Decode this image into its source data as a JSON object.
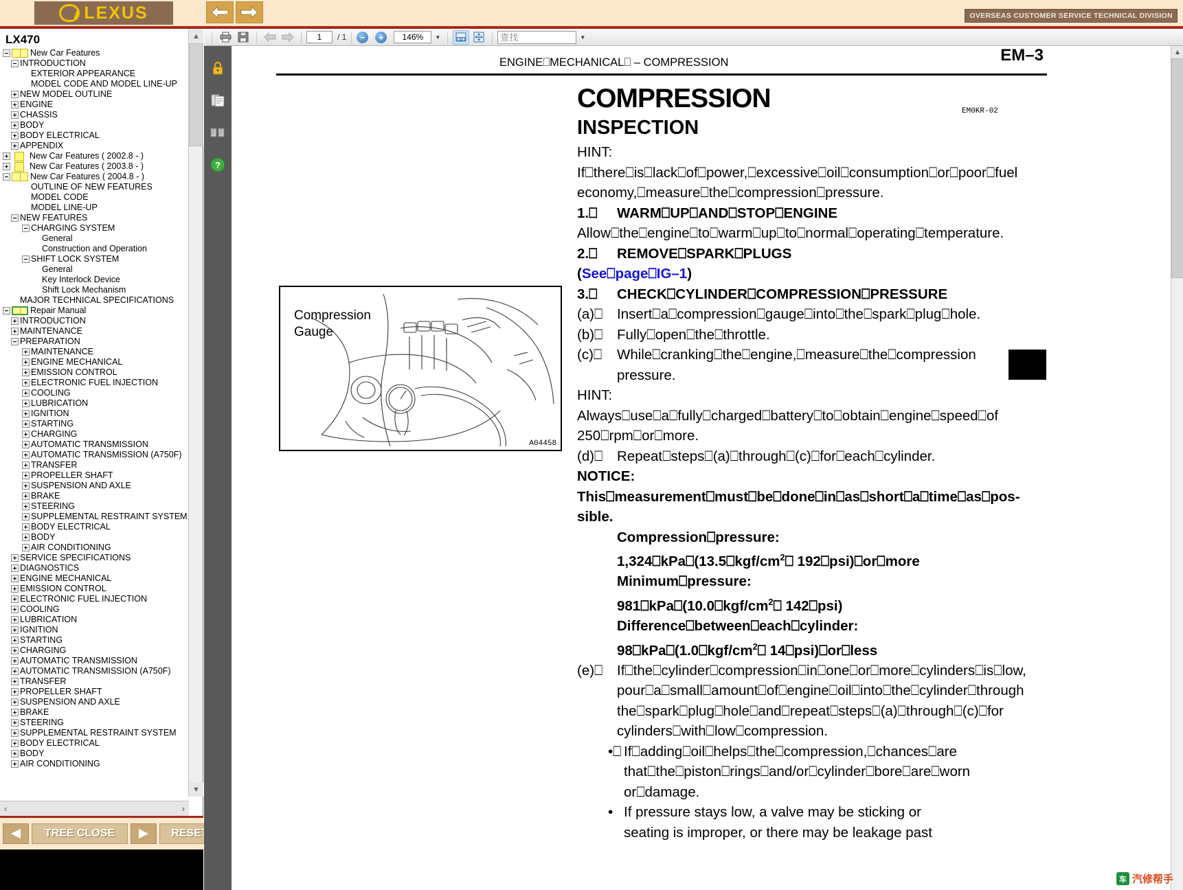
{
  "banner": {
    "logo_text": "LEXUS",
    "back_arrow": "back-arrow",
    "forward_arrow": "forward-arrow",
    "division_tag": "OVERSEAS CUSTOMER SERVICE TECHNICAL DIVISION"
  },
  "tree": {
    "title": "LX470",
    "items": [
      {
        "depth": 0,
        "toggle": "minus",
        "icon": "book",
        "label": "New Car Features"
      },
      {
        "depth": 1,
        "toggle": "minus",
        "icon": "none",
        "label": "INTRODUCTION"
      },
      {
        "depth": 2,
        "toggle": "none",
        "icon": "none",
        "label": "EXTERIOR APPEARANCE"
      },
      {
        "depth": 2,
        "toggle": "none",
        "icon": "none",
        "label": "MODEL CODE AND MODEL LINE-UP"
      },
      {
        "depth": 1,
        "toggle": "plus",
        "icon": "none",
        "label": "NEW MODEL OUTLINE"
      },
      {
        "depth": 1,
        "toggle": "plus",
        "icon": "none",
        "label": "ENGINE"
      },
      {
        "depth": 1,
        "toggle": "plus",
        "icon": "none",
        "label": "CHASSIS"
      },
      {
        "depth": 1,
        "toggle": "plus",
        "icon": "none",
        "label": "BODY"
      },
      {
        "depth": 1,
        "toggle": "plus",
        "icon": "none",
        "label": "BODY ELECTRICAL"
      },
      {
        "depth": 1,
        "toggle": "plus",
        "icon": "none",
        "label": "APPENDIX"
      },
      {
        "depth": 0,
        "toggle": "plus",
        "icon": "note",
        "label": "New Car Features ( 2002.8 - )"
      },
      {
        "depth": 0,
        "toggle": "plus",
        "icon": "note",
        "label": "New Car Features ( 2003.8 - )"
      },
      {
        "depth": 0,
        "toggle": "minus",
        "icon": "book",
        "label": "New Car Features ( 2004.8 - )"
      },
      {
        "depth": 2,
        "toggle": "none",
        "icon": "none",
        "label": "OUTLINE OF NEW FEATURES"
      },
      {
        "depth": 2,
        "toggle": "none",
        "icon": "none",
        "label": "MODEL CODE"
      },
      {
        "depth": 2,
        "toggle": "none",
        "icon": "none",
        "label": "MODEL LINE-UP"
      },
      {
        "depth": 1,
        "toggle": "minus",
        "icon": "none",
        "label": "NEW FEATURES"
      },
      {
        "depth": 2,
        "toggle": "minus",
        "icon": "none",
        "label": "CHARGING SYSTEM"
      },
      {
        "depth": 3,
        "toggle": "none",
        "icon": "none",
        "label": "General"
      },
      {
        "depth": 3,
        "toggle": "none",
        "icon": "none",
        "label": "Construction and Operation"
      },
      {
        "depth": 2,
        "toggle": "minus",
        "icon": "none",
        "label": "SHIFT LOCK SYSTEM"
      },
      {
        "depth": 3,
        "toggle": "none",
        "icon": "none",
        "label": "General"
      },
      {
        "depth": 3,
        "toggle": "none",
        "icon": "none",
        "label": "Key Interlock Device"
      },
      {
        "depth": 3,
        "toggle": "none",
        "icon": "none",
        "label": "Shift Lock Mechanism"
      },
      {
        "depth": 1,
        "toggle": "none",
        "icon": "none",
        "label": "MAJOR TECHNICAL SPECIFICATIONS"
      },
      {
        "depth": 0,
        "toggle": "minus",
        "icon": "book-green",
        "label": "Repair Manual"
      },
      {
        "depth": 1,
        "toggle": "plus",
        "icon": "none",
        "label": "INTRODUCTION"
      },
      {
        "depth": 1,
        "toggle": "plus",
        "icon": "none",
        "label": "MAINTENANCE"
      },
      {
        "depth": 1,
        "toggle": "minus",
        "icon": "none",
        "label": "PREPARATION"
      },
      {
        "depth": 2,
        "toggle": "plus",
        "icon": "none",
        "label": "MAINTENANCE"
      },
      {
        "depth": 2,
        "toggle": "plus",
        "icon": "none",
        "label": "ENGINE MECHANICAL"
      },
      {
        "depth": 2,
        "toggle": "plus",
        "icon": "none",
        "label": "EMISSION CONTROL"
      },
      {
        "depth": 2,
        "toggle": "plus",
        "icon": "none",
        "label": "ELECTRONIC FUEL INJECTION"
      },
      {
        "depth": 2,
        "toggle": "plus",
        "icon": "none",
        "label": "COOLING"
      },
      {
        "depth": 2,
        "toggle": "plus",
        "icon": "none",
        "label": "LUBRICATION"
      },
      {
        "depth": 2,
        "toggle": "plus",
        "icon": "none",
        "label": "IGNITION"
      },
      {
        "depth": 2,
        "toggle": "plus",
        "icon": "none",
        "label": "STARTING"
      },
      {
        "depth": 2,
        "toggle": "plus",
        "icon": "none",
        "label": "CHARGING"
      },
      {
        "depth": 2,
        "toggle": "plus",
        "icon": "none",
        "label": "AUTOMATIC TRANSMISSION"
      },
      {
        "depth": 2,
        "toggle": "plus",
        "icon": "none",
        "label": "AUTOMATIC TRANSMISSION (A750F)"
      },
      {
        "depth": 2,
        "toggle": "plus",
        "icon": "none",
        "label": "TRANSFER"
      },
      {
        "depth": 2,
        "toggle": "plus",
        "icon": "none",
        "label": "PROPELLER SHAFT"
      },
      {
        "depth": 2,
        "toggle": "plus",
        "icon": "none",
        "label": "SUSPENSION AND AXLE"
      },
      {
        "depth": 2,
        "toggle": "plus",
        "icon": "none",
        "label": "BRAKE"
      },
      {
        "depth": 2,
        "toggle": "plus",
        "icon": "none",
        "label": "STEERING"
      },
      {
        "depth": 2,
        "toggle": "plus",
        "icon": "none",
        "label": "SUPPLEMENTAL RESTRAINT SYSTEM"
      },
      {
        "depth": 2,
        "toggle": "plus",
        "icon": "none",
        "label": "BODY ELECTRICAL"
      },
      {
        "depth": 2,
        "toggle": "plus",
        "icon": "none",
        "label": "BODY"
      },
      {
        "depth": 2,
        "toggle": "plus",
        "icon": "none",
        "label": "AIR CONDITIONING"
      },
      {
        "depth": 1,
        "toggle": "plus",
        "icon": "none",
        "label": "SERVICE SPECIFICATIONS"
      },
      {
        "depth": 1,
        "toggle": "plus",
        "icon": "none",
        "label": "DIAGNOSTICS"
      },
      {
        "depth": 1,
        "toggle": "plus",
        "icon": "none",
        "label": "ENGINE MECHANICAL"
      },
      {
        "depth": 1,
        "toggle": "plus",
        "icon": "none",
        "label": "EMISSION CONTROL"
      },
      {
        "depth": 1,
        "toggle": "plus",
        "icon": "none",
        "label": "ELECTRONIC FUEL INJECTION"
      },
      {
        "depth": 1,
        "toggle": "plus",
        "icon": "none",
        "label": "COOLING"
      },
      {
        "depth": 1,
        "toggle": "plus",
        "icon": "none",
        "label": "LUBRICATION"
      },
      {
        "depth": 1,
        "toggle": "plus",
        "icon": "none",
        "label": "IGNITION"
      },
      {
        "depth": 1,
        "toggle": "plus",
        "icon": "none",
        "label": "STARTING"
      },
      {
        "depth": 1,
        "toggle": "plus",
        "icon": "none",
        "label": "CHARGING"
      },
      {
        "depth": 1,
        "toggle": "plus",
        "icon": "none",
        "label": "AUTOMATIC TRANSMISSION"
      },
      {
        "depth": 1,
        "toggle": "plus",
        "icon": "none",
        "label": "AUTOMATIC TRANSMISSION (A750F)"
      },
      {
        "depth": 1,
        "toggle": "plus",
        "icon": "none",
        "label": "TRANSFER"
      },
      {
        "depth": 1,
        "toggle": "plus",
        "icon": "none",
        "label": "PROPELLER SHAFT"
      },
      {
        "depth": 1,
        "toggle": "plus",
        "icon": "none",
        "label": "SUSPENSION AND AXLE"
      },
      {
        "depth": 1,
        "toggle": "plus",
        "icon": "none",
        "label": "BRAKE"
      },
      {
        "depth": 1,
        "toggle": "plus",
        "icon": "none",
        "label": "STEERING"
      },
      {
        "depth": 1,
        "toggle": "plus",
        "icon": "none",
        "label": "SUPPLEMENTAL RESTRAINT SYSTEM"
      },
      {
        "depth": 1,
        "toggle": "plus",
        "icon": "none",
        "label": "BODY ELECTRICAL"
      },
      {
        "depth": 1,
        "toggle": "plus",
        "icon": "none",
        "label": "BODY"
      },
      {
        "depth": 1,
        "toggle": "plus",
        "icon": "none",
        "label": "AIR CONDITIONING"
      }
    ],
    "hscroll_left": "‹",
    "hscroll_right": "›"
  },
  "bottom_bar": {
    "prev_label": "prev-arrow",
    "tree_close_label": "TREE CLOSE",
    "next_label": "next-arrow",
    "reset_label": "RESET"
  },
  "toolbar": {
    "page_current": "1",
    "page_total": "/ 1",
    "zoom_value": "146%",
    "zoom_out": "−",
    "zoom_in": "+",
    "search_placeholder": "查找",
    "caret": "▼"
  },
  "rail": {
    "icons": [
      "lock-icon",
      "pages-icon",
      "signature-icon",
      "help-icon"
    ]
  },
  "document": {
    "header": "ENGINE⎕MECHANICAL⎕ –    COMPRESSION",
    "page_label": "EM–3",
    "doc_code": "EM0KR-02",
    "title": "COMPRESSION",
    "subtitle": "INSPECTION",
    "figure": {
      "label_line1": "Compression",
      "label_line2": "Gauge",
      "code": "A04458"
    },
    "lines": {
      "hint1": "HINT:",
      "p1a": "If⎕there⎕is⎕lack⎕of⎕power,⎕excessive⎕oil⎕consumption⎕or⎕poor⎕fuel",
      "p1b": "economy,⎕measure⎕the⎕compression⎕pressure.",
      "step1_num": "1.⎕",
      "step1_txt": "WARM⎕UP⎕AND⎕STOP⎕ENGINE",
      "step1_body": "Allow⎕the⎕engine⎕to⎕warm⎕up⎕to⎕normal⎕operating⎕temperature.",
      "step2_num": "2.⎕",
      "step2_txt": "REMOVE⎕SPARK⎕PLUGS",
      "step2_ref_open": "(",
      "step2_ref_link": "See⎕page⎕IG–1",
      "step2_ref_close": ")",
      "step3_num": "3.⎕",
      "step3_txt": "CHECK⎕CYLINDER⎕COMPRESSION⎕PRESSURE",
      "a_lab": "(a)⎕",
      "a_txt": "Insert⎕a⎕compression⎕gauge⎕into⎕the⎕spark⎕plug⎕hole.",
      "b_lab": "(b)⎕",
      "b_txt": "Fully⎕open⎕the⎕throttle.",
      "c_lab": "(c)⎕",
      "c_txt": "While⎕cranking⎕the⎕engine,⎕measure⎕the⎕compression",
      "c_txt2": "pressure.",
      "hint2": "HINT:",
      "p2a": "Always⎕use⎕a⎕fully⎕charged⎕battery⎕to⎕obtain⎕engine⎕speed⎕of",
      "p2b": "250⎕rpm⎕or⎕more.",
      "d_lab": "(d)⎕",
      "d_txt": "Repeat⎕steps⎕(a)⎕through⎕(c)⎕for⎕each⎕cylinder.",
      "notice": "NOTICE:",
      "notice_a": "This⎕measurement⎕must⎕be⎕done⎕in⎕as⎕short⎕a⎕time⎕as⎕pos-",
      "notice_b": "sible.",
      "spec1_title": "Compression⎕pressure:",
      "spec1_val_pre": "1,324⎕kPa⎕(13.5⎕kgf/cm",
      "spec1_val_sup": "2",
      "spec1_val_post": "⎕ 192⎕psi)⎕or⎕more",
      "spec2_title": "Minimum⎕pressure:",
      "spec2_val_pre": "981⎕kPa⎕(10.0⎕kgf/cm",
      "spec2_val_sup": "2",
      "spec2_val_post": "⎕ 142⎕psi)",
      "spec3_title": "Difference⎕between⎕each⎕cylinder:",
      "spec3_val_pre": "98⎕kPa⎕(1.0⎕kgf/cm",
      "spec3_val_sup": "2",
      "spec3_val_post": "⎕ 14⎕psi)⎕or⎕less",
      "e_lab": "(e)⎕",
      "e_txt1": "If⎕the⎕cylinder⎕compression⎕in⎕one⎕or⎕more⎕cylinders⎕is⎕low,",
      "e_txt2": "pour⎕a⎕small⎕amount⎕of⎕engine⎕oil⎕into⎕the⎕cylinder⎕through",
      "e_txt3": "the⎕spark⎕plug⎕hole⎕and⎕repeat⎕steps⎕(a)⎕through⎕(c)⎕for",
      "e_txt4": "cylinders⎕with⎕low⎕compression.",
      "bullet1_mark": "•⎕",
      "bullet1_a": "If⎕adding⎕oil⎕helps⎕the⎕compression,⎕chances⎕are",
      "bullet1_b": "that⎕the⎕piston⎕rings⎕and/or⎕cylinder⎕bore⎕are⎕worn",
      "bullet1_c": "or⎕damage.",
      "bullet2_mark": "•",
      "bullet2_a": "If  pressure  stays  low,  a  valve  may  be  sticking  or",
      "bullet2_b": "seating  is  improper,  or  there  may  be  leakage  past"
    }
  },
  "watermark": {
    "text": "汽修帮手",
    "badge": "车"
  }
}
